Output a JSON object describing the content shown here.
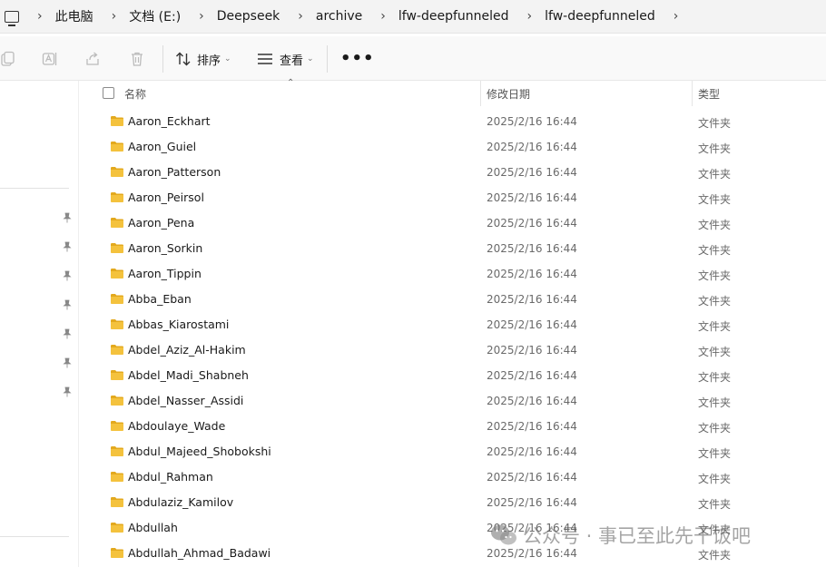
{
  "breadcrumb": {
    "items": [
      "此电脑",
      "文档 (E:)",
      "Deepseek",
      "archive",
      "lfw-deepfunneled",
      "lfw-deepfunneled"
    ]
  },
  "toolbar": {
    "sort_label": "排序",
    "view_label": "查看",
    "more_label": "•••"
  },
  "columns": {
    "name": "名称",
    "date": "修改日期",
    "type": "类型"
  },
  "files": [
    {
      "name": "Aaron_Eckhart",
      "date": "2025/2/16 16:44",
      "type": "文件夹"
    },
    {
      "name": "Aaron_Guiel",
      "date": "2025/2/16 16:44",
      "type": "文件夹"
    },
    {
      "name": "Aaron_Patterson",
      "date": "2025/2/16 16:44",
      "type": "文件夹"
    },
    {
      "name": "Aaron_Peirsol",
      "date": "2025/2/16 16:44",
      "type": "文件夹"
    },
    {
      "name": "Aaron_Pena",
      "date": "2025/2/16 16:44",
      "type": "文件夹"
    },
    {
      "name": "Aaron_Sorkin",
      "date": "2025/2/16 16:44",
      "type": "文件夹"
    },
    {
      "name": "Aaron_Tippin",
      "date": "2025/2/16 16:44",
      "type": "文件夹"
    },
    {
      "name": "Abba_Eban",
      "date": "2025/2/16 16:44",
      "type": "文件夹"
    },
    {
      "name": "Abbas_Kiarostami",
      "date": "2025/2/16 16:44",
      "type": "文件夹"
    },
    {
      "name": "Abdel_Aziz_Al-Hakim",
      "date": "2025/2/16 16:44",
      "type": "文件夹"
    },
    {
      "name": "Abdel_Madi_Shabneh",
      "date": "2025/2/16 16:44",
      "type": "文件夹"
    },
    {
      "name": "Abdel_Nasser_Assidi",
      "date": "2025/2/16 16:44",
      "type": "文件夹"
    },
    {
      "name": "Abdoulaye_Wade",
      "date": "2025/2/16 16:44",
      "type": "文件夹"
    },
    {
      "name": "Abdul_Majeed_Shobokshi",
      "date": "2025/2/16 16:44",
      "type": "文件夹"
    },
    {
      "name": "Abdul_Rahman",
      "date": "2025/2/16 16:44",
      "type": "文件夹"
    },
    {
      "name": "Abdulaziz_Kamilov",
      "date": "2025/2/16 16:44",
      "type": "文件夹"
    },
    {
      "name": "Abdullah",
      "date": "2025/2/16 16:44",
      "type": "文件夹"
    },
    {
      "name": "Abdullah_Ahmad_Badawi",
      "date": "2025/2/16 16:44",
      "type": "文件夹"
    }
  ],
  "watermark": {
    "text": "公众号 · 事已至此先干饭吧"
  },
  "colors": {
    "folder": "#f4c23d",
    "folder_dark": "#e3a91e",
    "header_text": "#555555",
    "meta_text": "#6a6a6a"
  }
}
